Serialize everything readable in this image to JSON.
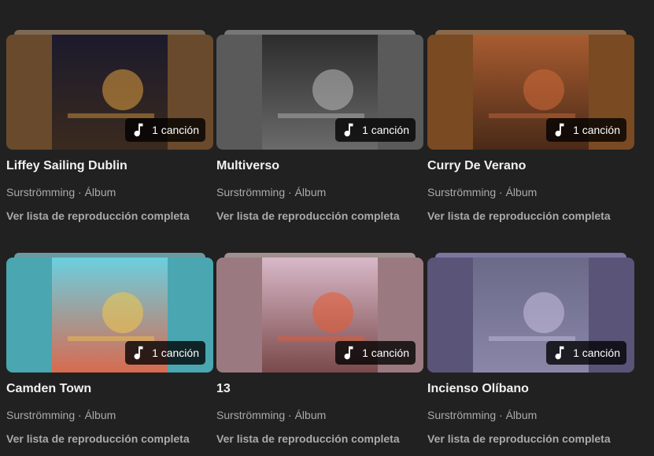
{
  "playlists": [
    {
      "title": "Liffey Sailing Dublin",
      "artist": "Surströmming",
      "separator": " · ",
      "type": "Álbum",
      "count": "1 canción",
      "link": "Ver lista de reproducción completa",
      "colors": {
        "side": "#6a4a2c",
        "art_top": "#1b1a2c",
        "art_bottom": "#3b2a1e",
        "accent": "#e0a040",
        "stack": "#7b6a58"
      }
    },
    {
      "title": "Multiverso",
      "artist": "Surströmming",
      "separator": " · ",
      "type": "Álbum",
      "count": "1 canción",
      "link": "Ver lista de reproducción completa",
      "colors": {
        "side": "#5a5a5a",
        "art_top": "#2c2c2c",
        "art_bottom": "#6a6a6a",
        "accent": "#bbbbbb",
        "stack": "#777777"
      }
    },
    {
      "title": "Curry De Verano",
      "artist": "Surströmming",
      "separator": " · ",
      "type": "Álbum",
      "count": "1 canción",
      "link": "Ver lista de reproducción completa",
      "colors": {
        "side": "#7a4a22",
        "art_top": "#a85c30",
        "art_bottom": "#4a2a18",
        "accent": "#d06a3a",
        "stack": "#8a6a4a"
      }
    },
    {
      "title": "Camden Town",
      "artist": "Surströmming",
      "separator": " · ",
      "type": "Álbum",
      "count": "1 canción",
      "link": "Ver lista de reproducción completa",
      "colors": {
        "side": "#4aa6b0",
        "art_top": "#6ad0e0",
        "art_bottom": "#d86a50",
        "accent": "#f2c84a",
        "stack": "#6a9aa0"
      }
    },
    {
      "title": "13",
      "artist": "Surströmming",
      "separator": " · ",
      "type": "Álbum",
      "count": "1 canción",
      "link": "Ver lista de reproducción completa",
      "colors": {
        "side": "#9a7a80",
        "art_top": "#d8b8c8",
        "art_bottom": "#7a4a4a",
        "accent": "#e85a30",
        "stack": "#a09090"
      }
    },
    {
      "title": "Incienso Olíbano",
      "artist": "Surströmming",
      "separator": " · ",
      "type": "Álbum",
      "count": "1 canción",
      "link": "Ver lista de reproducción completa",
      "colors": {
        "side": "#5a5478",
        "art_top": "#6a6a88",
        "art_bottom": "#8a86a8",
        "accent": "#c8c0e0",
        "stack": "#7a76a0"
      }
    }
  ]
}
